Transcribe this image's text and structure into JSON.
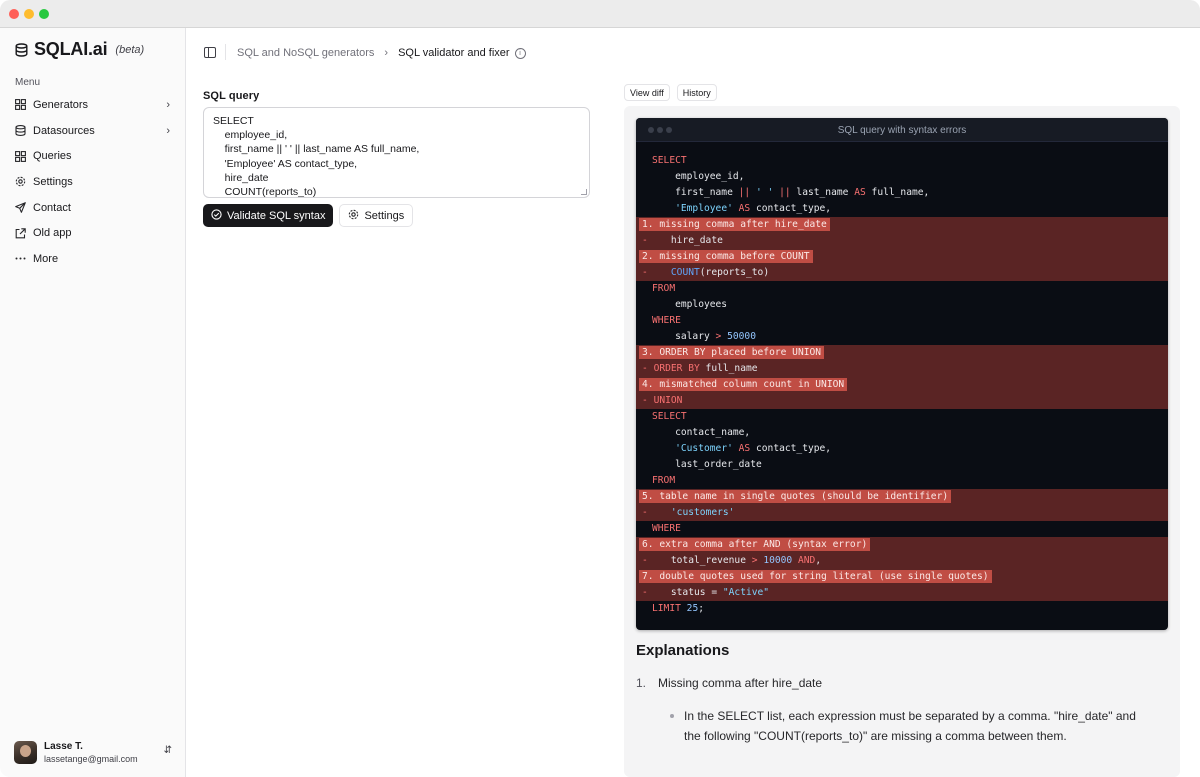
{
  "brand": {
    "name": "SQLAI.ai",
    "tag": "(beta)"
  },
  "sidebar": {
    "menu_label": "Menu",
    "items": [
      {
        "label": "Generators",
        "icon": "grid-icon",
        "has_chevron": true
      },
      {
        "label": "Datasources",
        "icon": "database-icon",
        "has_chevron": true
      },
      {
        "label": "Queries",
        "icon": "grid-icon",
        "has_chevron": false
      },
      {
        "label": "Settings",
        "icon": "gear-icon",
        "has_chevron": false
      },
      {
        "label": "Contact",
        "icon": "send-icon",
        "has_chevron": false
      },
      {
        "label": "Old app",
        "icon": "external-link-icon",
        "has_chevron": false
      },
      {
        "label": "More",
        "icon": "more-icon",
        "has_chevron": false
      }
    ],
    "user": {
      "name": "Lasse T.",
      "email": "lassetange@gmail.com"
    }
  },
  "breadcrumb": {
    "parent": "SQL and NoSQL generators",
    "current": "SQL validator and fixer"
  },
  "query_panel": {
    "label": "SQL query",
    "lines": [
      "SELECT",
      "    employee_id,",
      "    first_name || ' ' || last_name AS full_name,",
      "    'Employee' AS contact_type,",
      "    hire_date",
      "    COUNT(reports_to)"
    ],
    "validate_label": "Validate SQL syntax",
    "settings_label": "Settings"
  },
  "output": {
    "tabs": [
      "View diff",
      "History"
    ],
    "code_title": "SQL query with syntax errors",
    "colors": {
      "error_row": "#5a2424",
      "error_label": "#c04d44",
      "code_bg": "#0a0d14"
    },
    "code_lines": [
      {
        "t": "SELECT"
      },
      {
        "t": "    employee_id,"
      },
      {
        "t": "    first_name || ' ' || last_name AS full_name,"
      },
      {
        "t": "    'Employee' AS contact_type,"
      },
      {
        "t": "1. missing comma after hire_date",
        "err": true,
        "label": true
      },
      {
        "t": "-    hire_date",
        "err": true
      },
      {
        "t": "2. missing comma before COUNT",
        "err": true,
        "label": true
      },
      {
        "t": "-    COUNT(reports_to)",
        "err": true
      },
      {
        "t": "FROM"
      },
      {
        "t": "    employees"
      },
      {
        "t": "WHERE"
      },
      {
        "t": "    salary > 50000"
      },
      {
        "t": "3. ORDER BY placed before UNION",
        "err": true,
        "label": true
      },
      {
        "t": "- ORDER BY full_name",
        "err": true
      },
      {
        "t": "4. mismatched column count in UNION",
        "err": true,
        "label": true
      },
      {
        "t": "- UNION",
        "err": true
      },
      {
        "t": "SELECT"
      },
      {
        "t": "    contact_name,"
      },
      {
        "t": "    'Customer' AS contact_type,"
      },
      {
        "t": "    last_order_date"
      },
      {
        "t": "FROM"
      },
      {
        "t": "5. table name in single quotes (should be identifier)",
        "err": true,
        "label": true
      },
      {
        "t": "-    'customers'",
        "err": true
      },
      {
        "t": "WHERE"
      },
      {
        "t": "6. extra comma after AND (syntax error)",
        "err": true,
        "label": true
      },
      {
        "t": "-    total_revenue > 10000 AND,",
        "err": true
      },
      {
        "t": "7. double quotes used for string literal (use single quotes)",
        "err": true,
        "label": true
      },
      {
        "t": "-    status = \"Active\"",
        "err": true
      },
      {
        "t": "LIMIT 25;"
      }
    ]
  },
  "explanations": {
    "title": "Explanations",
    "first_item": "Missing comma after hire_date",
    "first_item_num": "1.",
    "first_detail": "In the SELECT list, each expression must be separated by a comma. \"hire_date\" and the following \"COUNT(reports_to)\" are missing a comma between them."
  }
}
